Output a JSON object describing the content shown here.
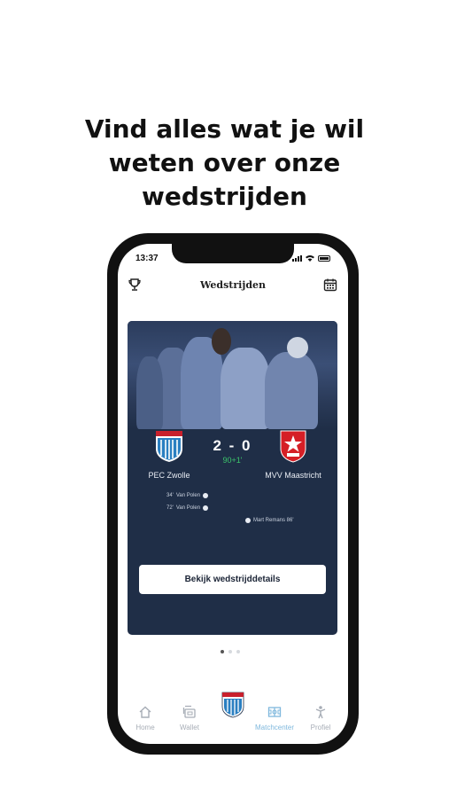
{
  "headline": {
    "line1": "Vind alles wat je wil",
    "line2": "weten over onze",
    "line3": "wedstrijden"
  },
  "status_bar": {
    "time": "13:37"
  },
  "header": {
    "title": "Wedstrijden",
    "left_icon": "trophy-icon",
    "right_icon": "calendar-icon"
  },
  "match": {
    "home_team": "PEC Zwolle",
    "away_team": "MVV Maastricht",
    "score": "2 - 0",
    "minute": "90+1'",
    "home_goals": [
      {
        "minute": "34'",
        "player": "Van Polen"
      },
      {
        "minute": "72'",
        "player": "Van Polen"
      }
    ],
    "away_goals": [
      {
        "text": "Mart Remans 86'"
      }
    ],
    "cta_label": "Bekijk wedstrijddetails",
    "accent_green": "#3cc46b"
  },
  "pager": {
    "count": 3,
    "active": 1
  },
  "tabbar": {
    "items": [
      {
        "label": "Home",
        "icon": "home-icon"
      },
      {
        "label": "Wallet",
        "icon": "wallet-icon"
      },
      {
        "label": "",
        "icon": "club-crest-icon"
      },
      {
        "label": "Matchcenter",
        "icon": "pitch-icon",
        "active": true
      },
      {
        "label": "Profiel",
        "icon": "person-icon"
      }
    ]
  },
  "colors": {
    "card_bg": "#1f2e47",
    "active_tab": "#7fb8dd"
  }
}
